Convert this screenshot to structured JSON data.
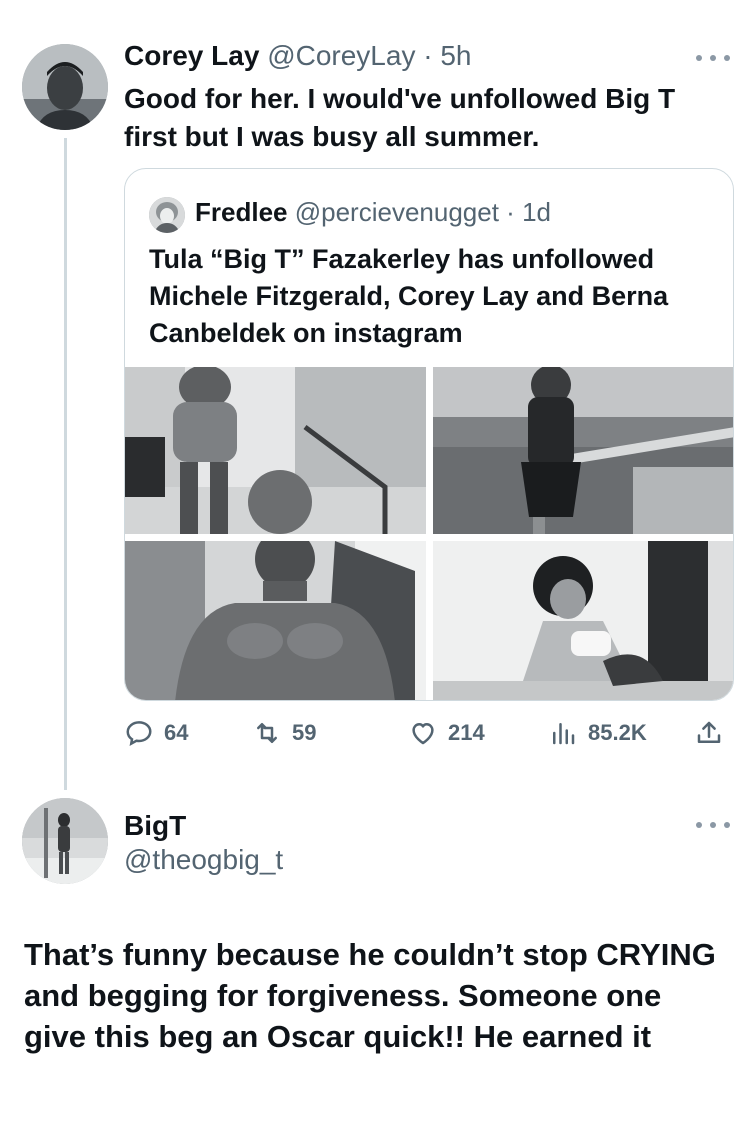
{
  "tweet": {
    "author_name": "Corey Lay",
    "author_handle": "@CoreyLay",
    "separator": "·",
    "time": "5h",
    "text": "Good for her. I would've unfollowed Big T first but I was busy all summer.",
    "more_icon": "more-options-icon",
    "quote": {
      "author_name": "Fredlee",
      "author_handle": "@percievenugget",
      "separator": "·",
      "time": "1d",
      "text": "Tula “Big T” Fazakerley has unfollowed Michele Fitzgerald, Corey Lay and Berna Canbeldek on instagram"
    },
    "actions": {
      "replies": "64",
      "retweets": "59",
      "likes": "214",
      "views": "85.2K"
    }
  },
  "reply": {
    "author_name": "BigT",
    "author_handle": "@theogbig_t",
    "text": "That’s funny because he couldn’t stop CRYING and begging for forgiveness. Someone one give this beg an Oscar quick!! He earned it"
  }
}
